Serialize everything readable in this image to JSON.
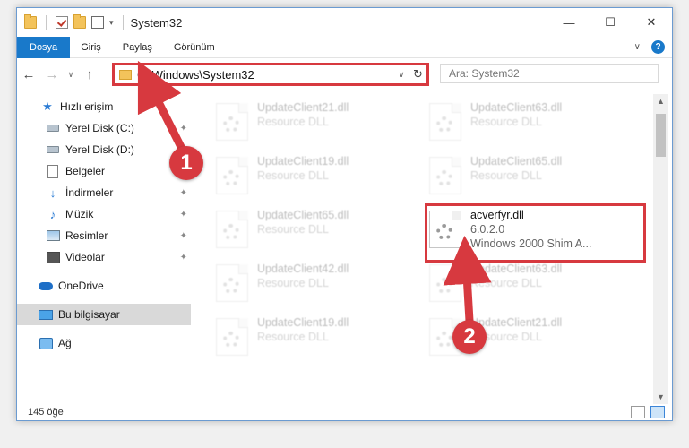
{
  "window": {
    "title": "System32",
    "controls": {
      "minimize": "—",
      "maximize": "☐",
      "close": "✕"
    }
  },
  "ribbon": {
    "tabs": [
      {
        "label": "Dosya"
      },
      {
        "label": "Giriş"
      },
      {
        "label": "Paylaş"
      },
      {
        "label": "Görünüm"
      }
    ],
    "help": "?"
  },
  "address": {
    "path": "C:\\Windows\\System32",
    "search_placeholder": "Ara: System32"
  },
  "nav": {
    "items": [
      {
        "label": "Hızlı erişim",
        "icon": "star-icon"
      },
      {
        "label": "Yerel Disk (C:)",
        "icon": "disk-icon"
      },
      {
        "label": "Yerel Disk (D:)",
        "icon": "disk-icon"
      },
      {
        "label": "Belgeler",
        "icon": "document-icon"
      },
      {
        "label": "İndirmeler",
        "icon": "download-icon"
      },
      {
        "label": "Müzik",
        "icon": "music-icon"
      },
      {
        "label": "Resimler",
        "icon": "pictures-icon"
      },
      {
        "label": "Videolar",
        "icon": "videos-icon"
      },
      {
        "label": "OneDrive",
        "icon": "cloud-icon"
      },
      {
        "label": "Bu bilgisayar",
        "icon": "computer-icon"
      },
      {
        "label": "Ağ",
        "icon": "network-icon"
      }
    ]
  },
  "files": [
    {
      "name": "UpdateClient21.dll",
      "desc": "Resource DLL"
    },
    {
      "name": "UpdateClient63.dll",
      "desc": "Resource DLL"
    },
    {
      "name": "UpdateClient19.dll",
      "desc": "Resource DLL"
    },
    {
      "name": "UpdateClient65.dll",
      "desc": "Resource DLL"
    },
    {
      "name": "UpdateClient65.dll",
      "desc": "Resource DLL"
    },
    {
      "name": "acverfyr.dll",
      "version": "6.0.2.0",
      "desc": "Windows 2000 Shim A..."
    },
    {
      "name": "UpdateClient42.dll",
      "desc": "Resource DLL"
    },
    {
      "name": "UpdateClient63.dll",
      "desc": "Resource DLL"
    },
    {
      "name": "UpdateClient19.dll",
      "desc": "Resource DLL"
    },
    {
      "name": "UpdateClient21.dll",
      "desc": "Resource DLL"
    }
  ],
  "status": {
    "count": "145 öğe"
  },
  "annotations": {
    "step1": "1",
    "step2": "2"
  },
  "colors": {
    "accent": "#1979ca",
    "highlight": "#d7393f"
  }
}
